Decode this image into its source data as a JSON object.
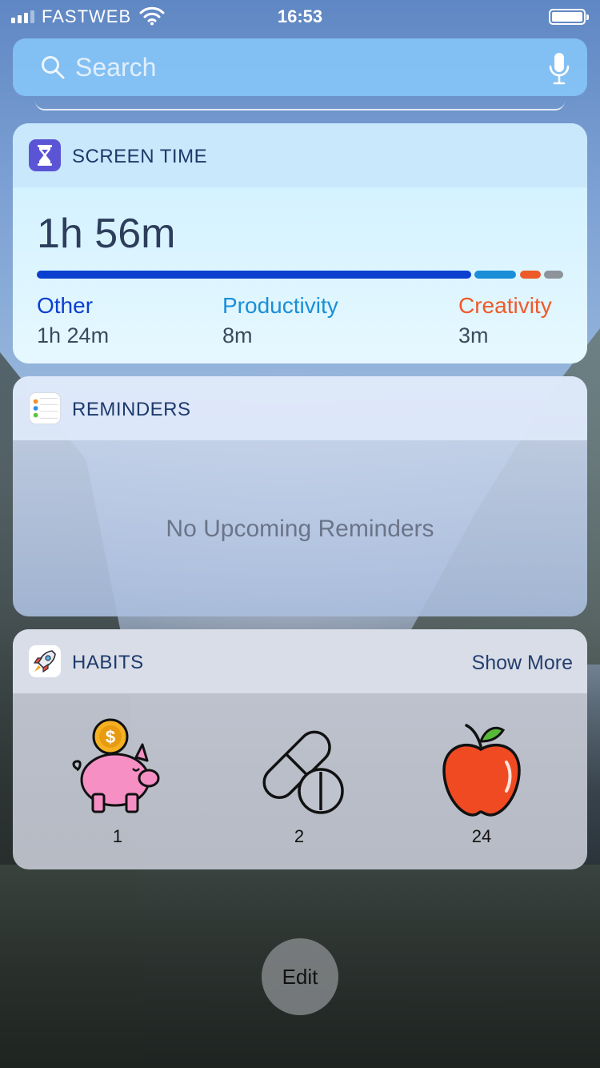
{
  "status_bar": {
    "carrier": "FASTWEB",
    "time": "16:53",
    "signal_bars_filled": 3
  },
  "search": {
    "placeholder": "Search"
  },
  "screen_time": {
    "title": "SCREEN TIME",
    "total": "1h 56m",
    "categories": [
      {
        "label": "Other",
        "value": "1h 24m",
        "color": "#0b3fd0"
      },
      {
        "label": "Productivity",
        "value": "8m",
        "color": "#1a8fd8"
      },
      {
        "label": "Creativity",
        "value": "3m",
        "color": "#ef5a2a"
      }
    ],
    "extra_color": "#8e939a"
  },
  "reminders": {
    "title": "REMINDERS",
    "empty_message": "No Upcoming Reminders"
  },
  "habits": {
    "title": "HABITS",
    "show_more": "Show More",
    "items": [
      {
        "icon": "piggy-bank-icon",
        "count": "1"
      },
      {
        "icon": "pill-icon",
        "count": "2"
      },
      {
        "icon": "apple-icon",
        "count": "24"
      }
    ]
  },
  "edit_label": "Edit"
}
